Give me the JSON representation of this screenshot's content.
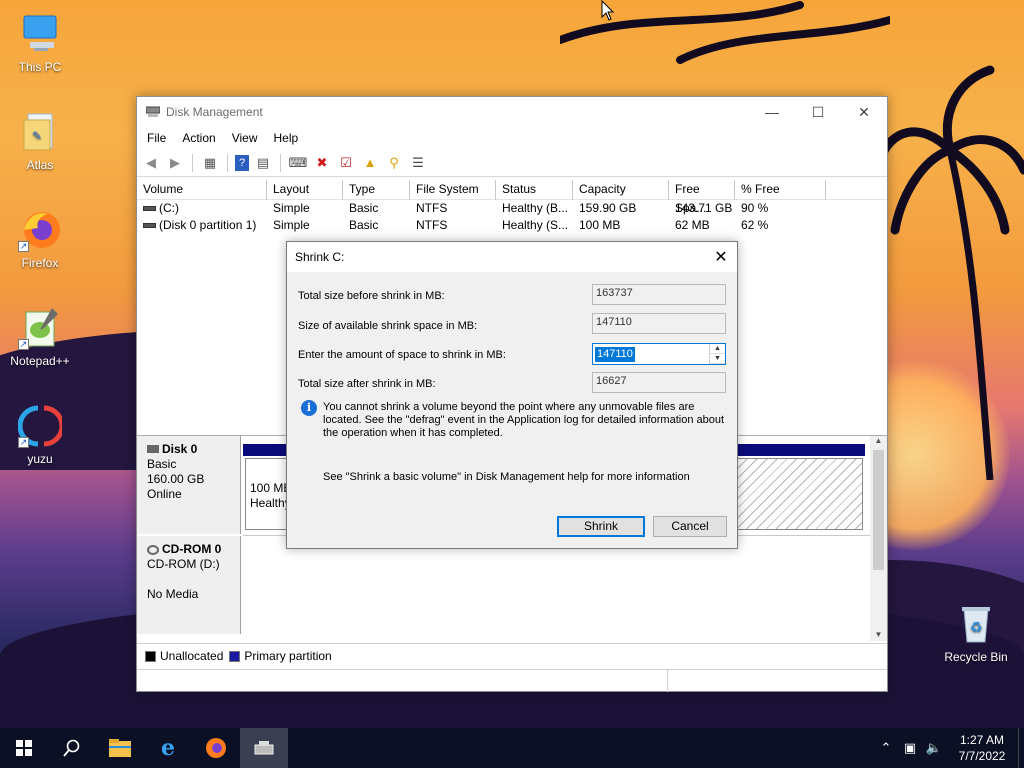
{
  "desktop": {
    "icons": [
      {
        "label": "This PC"
      },
      {
        "label": "Atlas"
      },
      {
        "label": "Firefox"
      },
      {
        "label": "Notepad++"
      },
      {
        "label": "yuzu"
      },
      {
        "label": "Recycle Bin"
      }
    ]
  },
  "window": {
    "title": "Disk Management",
    "menu": [
      "File",
      "Action",
      "View",
      "Help"
    ],
    "columns": [
      "Volume",
      "Layout",
      "Type",
      "File System",
      "Status",
      "Capacity",
      "Free Spa...",
      "% Free"
    ],
    "rows": [
      {
        "volume": "(C:)",
        "layout": "Simple",
        "type": "Basic",
        "fs": "NTFS",
        "status": "Healthy (B...",
        "capacity": "159.90 GB",
        "free": "143.71 GB",
        "pct": "90 %"
      },
      {
        "volume": "(Disk 0 partition 1)",
        "layout": "Simple",
        "type": "Basic",
        "fs": "NTFS",
        "status": "Healthy (S...",
        "capacity": "100 MB",
        "free": "62 MB",
        "pct": "62 %"
      }
    ],
    "disk0": {
      "name": "Disk 0",
      "type": "Basic",
      "size": "160.00 GB",
      "state": "Online",
      "part_size": "100 MB",
      "part_status": "Healthy"
    },
    "cdrom": {
      "name": "CD-ROM 0",
      "label": "CD-ROM (D:)",
      "media": "No Media"
    },
    "legend": {
      "unallocated": "Unallocated",
      "primary": "Primary partition",
      "unallocated_color": "#000000",
      "primary_color": "#1a1aa0"
    },
    "disk_bar_color": "#0a0a7a"
  },
  "dialog": {
    "title": "Shrink C:",
    "total_before_label": "Total size before shrink in MB:",
    "total_before": "163737",
    "available_label": "Size of available shrink space in MB:",
    "available": "147110",
    "enter_label": "Enter the amount of space to shrink in MB:",
    "enter_value": "147110",
    "total_after_label": "Total size after shrink in MB:",
    "total_after": "16627",
    "info": "You cannot shrink a volume beyond the point where any unmovable files are located. See the \"defrag\" event in the Application log for detailed information about the operation when it has completed.",
    "help": "See \"Shrink a basic volume\" in Disk Management help for more information",
    "shrink_button": "Shrink",
    "cancel_button": "Cancel"
  },
  "taskbar": {
    "time": "1:27 AM",
    "date": "7/7/2022"
  }
}
